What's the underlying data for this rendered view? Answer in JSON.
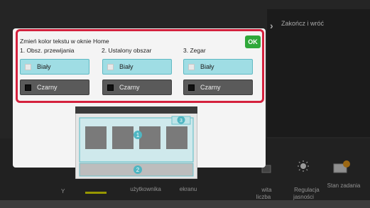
{
  "right_panel": {
    "label": "Zakończ i wróć"
  },
  "bottom_bar": {
    "items": [
      {
        "label": "użytkownika"
      },
      {
        "label": "ekranu"
      },
      {
        "label": "wita\nliczba"
      },
      {
        "label": "Regulacja\njasności"
      },
      {
        "label": "Stan zadania"
      }
    ]
  },
  "dialog": {
    "title": "Zmień kolor tekstu w oknie Home",
    "ok_label": "OK",
    "columns": [
      {
        "header": "1. Obsz. przewijania",
        "white_label": "Biały",
        "black_label": "Czarny"
      },
      {
        "header": "2. Ustalony obszar",
        "white_label": "Biały",
        "black_label": "Czarny"
      },
      {
        "header": "3. Zegar",
        "white_label": "Biały",
        "black_label": "Czarny"
      }
    ]
  },
  "preview": {
    "markers": [
      "1",
      "2",
      "3"
    ]
  },
  "colors": {
    "accent_red": "#d4213d",
    "ok_green": "#2fa83a",
    "white_btn": "#9fdde4",
    "black_btn": "#5a5a5a"
  }
}
